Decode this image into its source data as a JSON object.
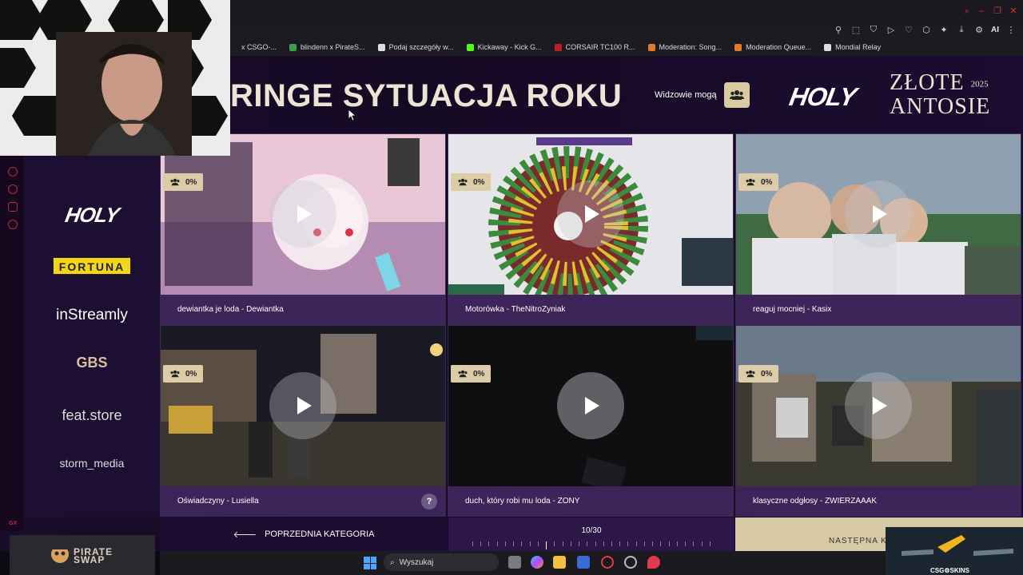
{
  "browser": {
    "bookmarks": [
      {
        "label": "x CSGO-...",
        "icon": "bookmark-icon",
        "color": "#1c1b21"
      },
      {
        "label": "blindenn x PirateS...",
        "icon": "plus-icon",
        "color": "#3aa04a"
      },
      {
        "label": "Podaj szczegóły w...",
        "icon": "page-icon",
        "color": "#ddd"
      },
      {
        "label": "Kickaway - Kick G...",
        "icon": "kick-icon",
        "color": "#53fc18"
      },
      {
        "label": "CORSAIR TC100 R...",
        "icon": "corsair-icon",
        "color": "#b8202a"
      },
      {
        "label": "Moderation: Song...",
        "icon": "mod-icon",
        "color": "#e07a2c"
      },
      {
        "label": "Moderation Queue...",
        "icon": "mod-icon",
        "color": "#e07a2c"
      },
      {
        "label": "Mondial Relay",
        "icon": "page-icon",
        "color": "#ddd"
      }
    ],
    "toolbar_ai": "AI"
  },
  "header": {
    "title": "RINGE SYTUACJA ROKU",
    "viewers_label": "Widzowie mogą",
    "brand_logo": "HOLY",
    "event_line1": "ZŁOTE",
    "event_year": "2025",
    "event_line2": "ANTOSIE"
  },
  "sponsors": {
    "holy": "HOLY",
    "fortuna": "FORTUNA",
    "instreamly": "inStreamly",
    "gbs": "GBS",
    "feat": "feat.store",
    "storm": "storm_media"
  },
  "clips": [
    {
      "title": "dewiantka je loda - Dewiantka",
      "percent": "0%"
    },
    {
      "title": "Motorówka - TheNitroZyniak",
      "percent": "0%"
    },
    {
      "title": "reaguj mocniej - Kasix",
      "percent": "0%"
    },
    {
      "title": "Oświadczyny - Lusiella",
      "percent": "0%"
    },
    {
      "title": "duch, który robi mu loda - ZONY",
      "percent": "0%"
    },
    {
      "title": "klasyczne odgłosy - ZWIERZAAAK",
      "percent": "0%"
    }
  ],
  "navigation": {
    "prev_label": "POPRZEDNIA KATEGORIA",
    "counter": "10/30",
    "current": 10,
    "total": 30,
    "next_label": "NASTĘPNA KAT"
  },
  "overlays": {
    "pirate_line1": "PIRATE",
    "pirate_line2": "SWAP",
    "csgo": "CSG⚙SKINS",
    "gx": "GX"
  },
  "taskbar": {
    "search_placeholder": "Wyszukaj"
  },
  "colors": {
    "accent": "#dccda8",
    "caption_bg": "#3d2459",
    "page_bg": "#1a0d2c"
  }
}
